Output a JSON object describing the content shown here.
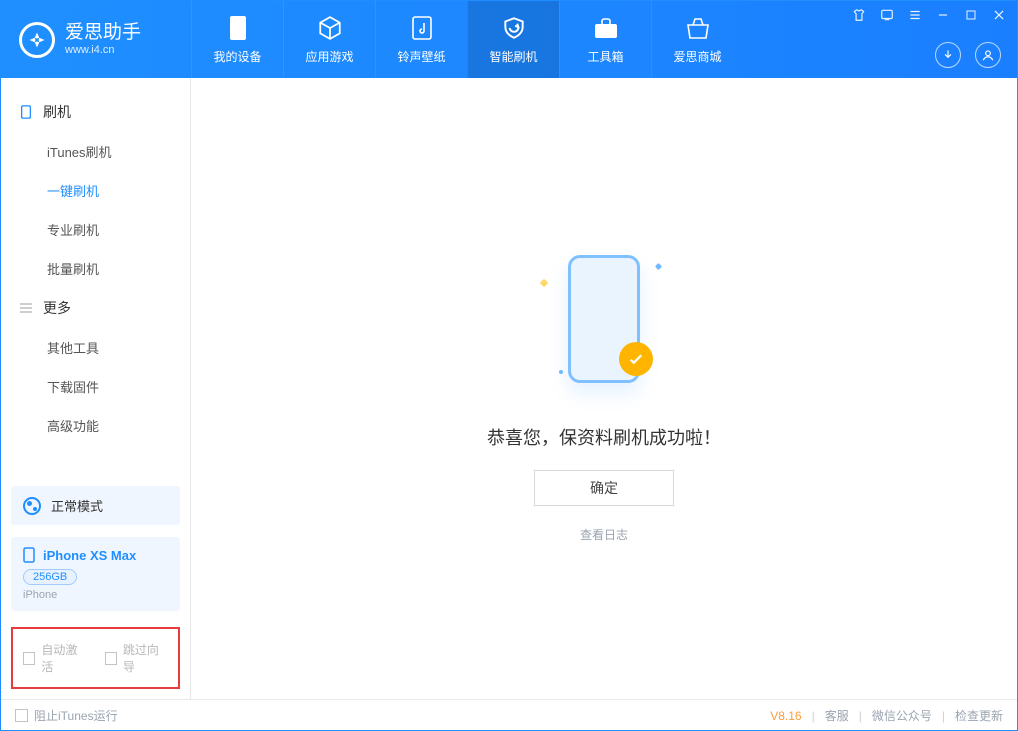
{
  "app": {
    "name_zh": "爱思助手",
    "name_en": "www.i4.cn"
  },
  "top_tabs": [
    {
      "label": "我的设备"
    },
    {
      "label": "应用游戏"
    },
    {
      "label": "铃声壁纸"
    },
    {
      "label": "智能刷机"
    },
    {
      "label": "工具箱"
    },
    {
      "label": "爱思商城"
    }
  ],
  "sidebar": {
    "group1_title": "刷机",
    "group1_items": [
      "iTunes刷机",
      "一键刷机",
      "专业刷机",
      "批量刷机"
    ],
    "group2_title": "更多",
    "group2_items": [
      "其他工具",
      "下载固件",
      "高级功能"
    ]
  },
  "device_mode": "正常模式",
  "device": {
    "name": "iPhone XS Max",
    "storage": "256GB",
    "type": "iPhone"
  },
  "options": {
    "auto_activate": "自动激活",
    "skip_guide": "跳过向导"
  },
  "main": {
    "success_text": "恭喜您，保资料刷机成功啦！",
    "ok_button": "确定",
    "view_log": "查看日志"
  },
  "footer": {
    "block_itunes": "阻止iTunes运行",
    "version": "V8.16",
    "links": [
      "客服",
      "微信公众号",
      "检查更新"
    ]
  }
}
